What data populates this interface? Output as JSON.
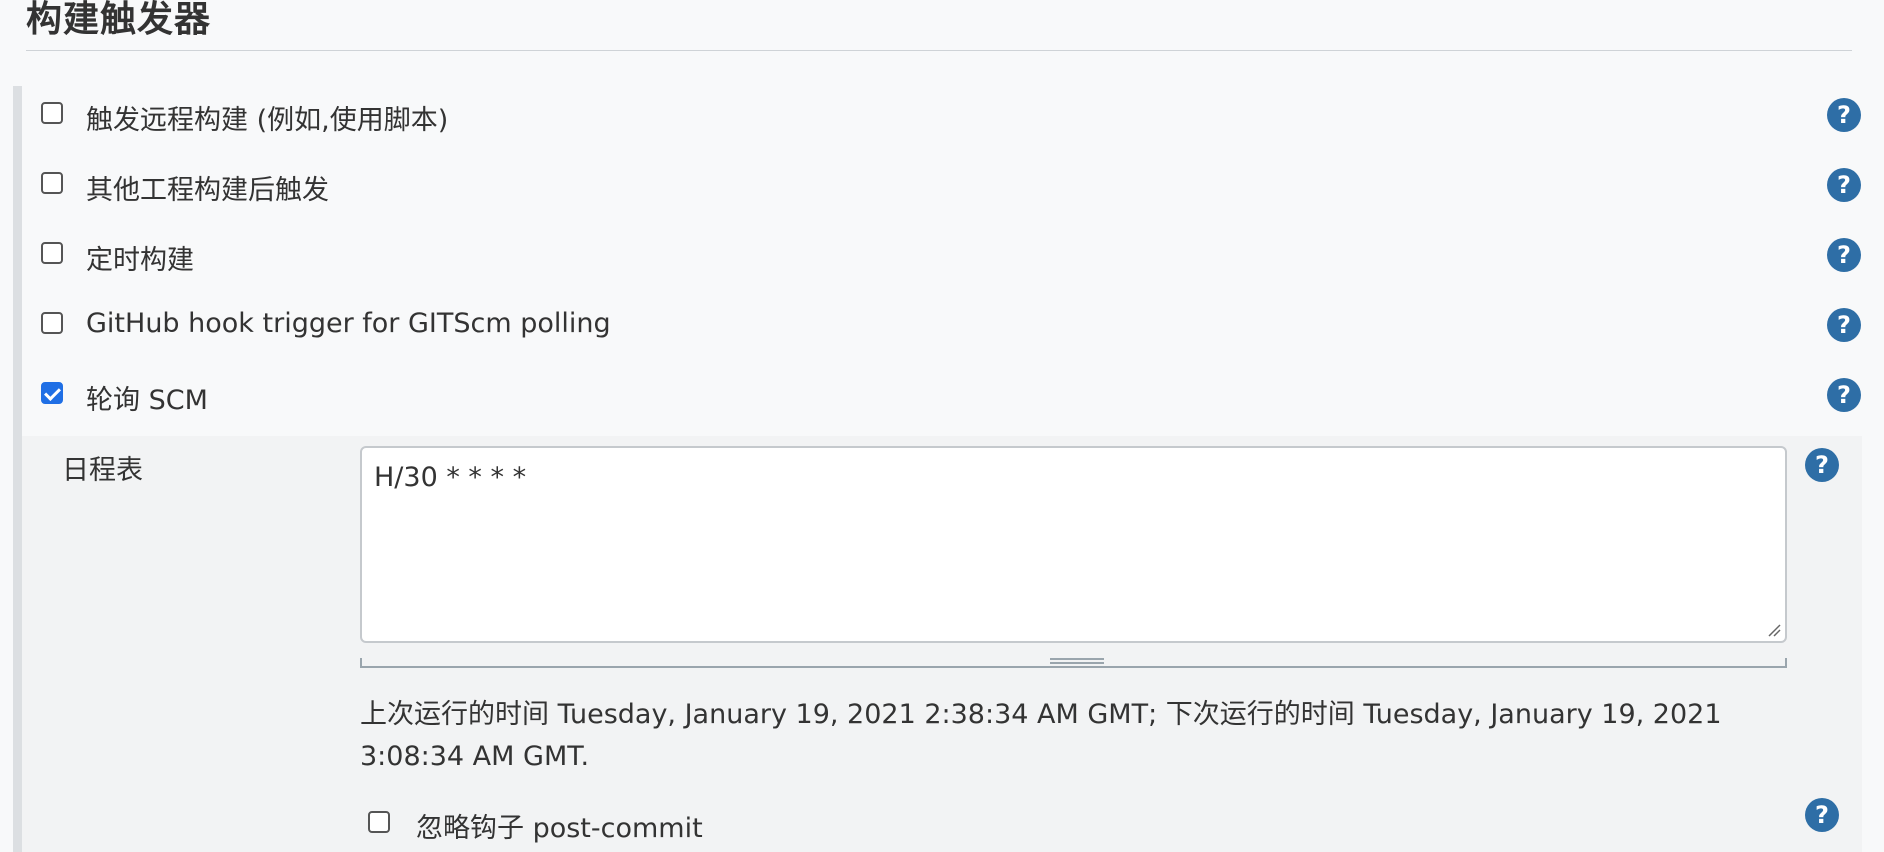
{
  "section": {
    "title": "构建触发器"
  },
  "triggers": [
    {
      "label": "触发远程构建 (例如,使用脚本)",
      "checked": false
    },
    {
      "label": "其他工程构建后触发",
      "checked": false
    },
    {
      "label": "定时构建",
      "checked": false
    },
    {
      "label": "GitHub hook trigger for GITScm polling",
      "checked": false
    },
    {
      "label": "轮询 SCM",
      "checked": true
    }
  ],
  "scm": {
    "schedule_label": "日程表",
    "schedule_value": "H/30 * * * *",
    "run_info": "上次运行的时间 Tuesday, January 19, 2021 2:38:34 AM GMT; 下次运行的时间 Tuesday, January 19, 2021 3:08:34 AM GMT.",
    "ignore_hook_label": "忽略钩子 post-commit",
    "ignore_hook_checked": false
  },
  "help_symbol": "?",
  "colors": {
    "help": "#2e6ea6",
    "checkbox_checked": "#1f6fe5"
  },
  "icons": {
    "help": "question-circle-icon",
    "checkmark": "checkmark-icon"
  }
}
